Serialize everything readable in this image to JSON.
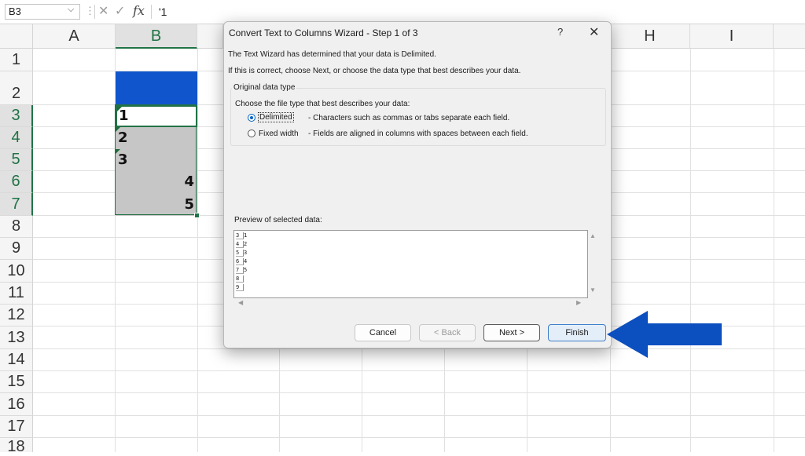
{
  "formula_bar": {
    "name_box": "B3",
    "content": "'1"
  },
  "columns": [
    {
      "label": "A",
      "selected": false
    },
    {
      "label": "B",
      "selected": true
    },
    {
      "label": "H",
      "selected": false
    },
    {
      "label": "I",
      "selected": false
    }
  ],
  "rows": [
    "1",
    "2",
    "3",
    "4",
    "5",
    "6",
    "7",
    "8",
    "9",
    "10",
    "11",
    "12",
    "13",
    "14",
    "15",
    "16",
    "17",
    "18"
  ],
  "selected_rows": [
    "3",
    "4",
    "5",
    "6",
    "7"
  ],
  "cells": {
    "b3": "1",
    "b4": "2",
    "b5": "3",
    "b6": "4",
    "b7": "5"
  },
  "dialog": {
    "title": "Convert Text to Columns Wizard - Step 1 of 3",
    "help": "?",
    "close": "✕",
    "intro_line1": "The Text Wizard has determined that your data is Delimited.",
    "intro_line2": "If this is correct, choose Next, or choose the data type that best describes your data.",
    "group_label": "Original data type",
    "group_prompt": "Choose the file type that best describes your data:",
    "options": [
      {
        "label": "Delimited",
        "description": "- Characters such as commas or tabs separate each field.",
        "selected": true
      },
      {
        "label": "Fixed width",
        "description": "- Fields are aligned in columns with spaces between each field.",
        "selected": false
      }
    ],
    "preview_label": "Preview of selected data:",
    "preview_rows": [
      {
        "num": "3",
        "text": "1"
      },
      {
        "num": "4",
        "text": "2"
      },
      {
        "num": "5",
        "text": "3"
      },
      {
        "num": "6",
        "text": "4"
      },
      {
        "num": "7",
        "text": "5"
      },
      {
        "num": "8",
        "text": ""
      },
      {
        "num": "9",
        "text": ""
      }
    ],
    "buttons": {
      "cancel": "Cancel",
      "back": "< Back",
      "next": "Next >",
      "finish": "Finish"
    }
  },
  "colors": {
    "accent_green": "#217346",
    "header_fill": "#1155cc",
    "arrow": "#0c4fbf",
    "selection_gray": "#c6c6c6"
  }
}
